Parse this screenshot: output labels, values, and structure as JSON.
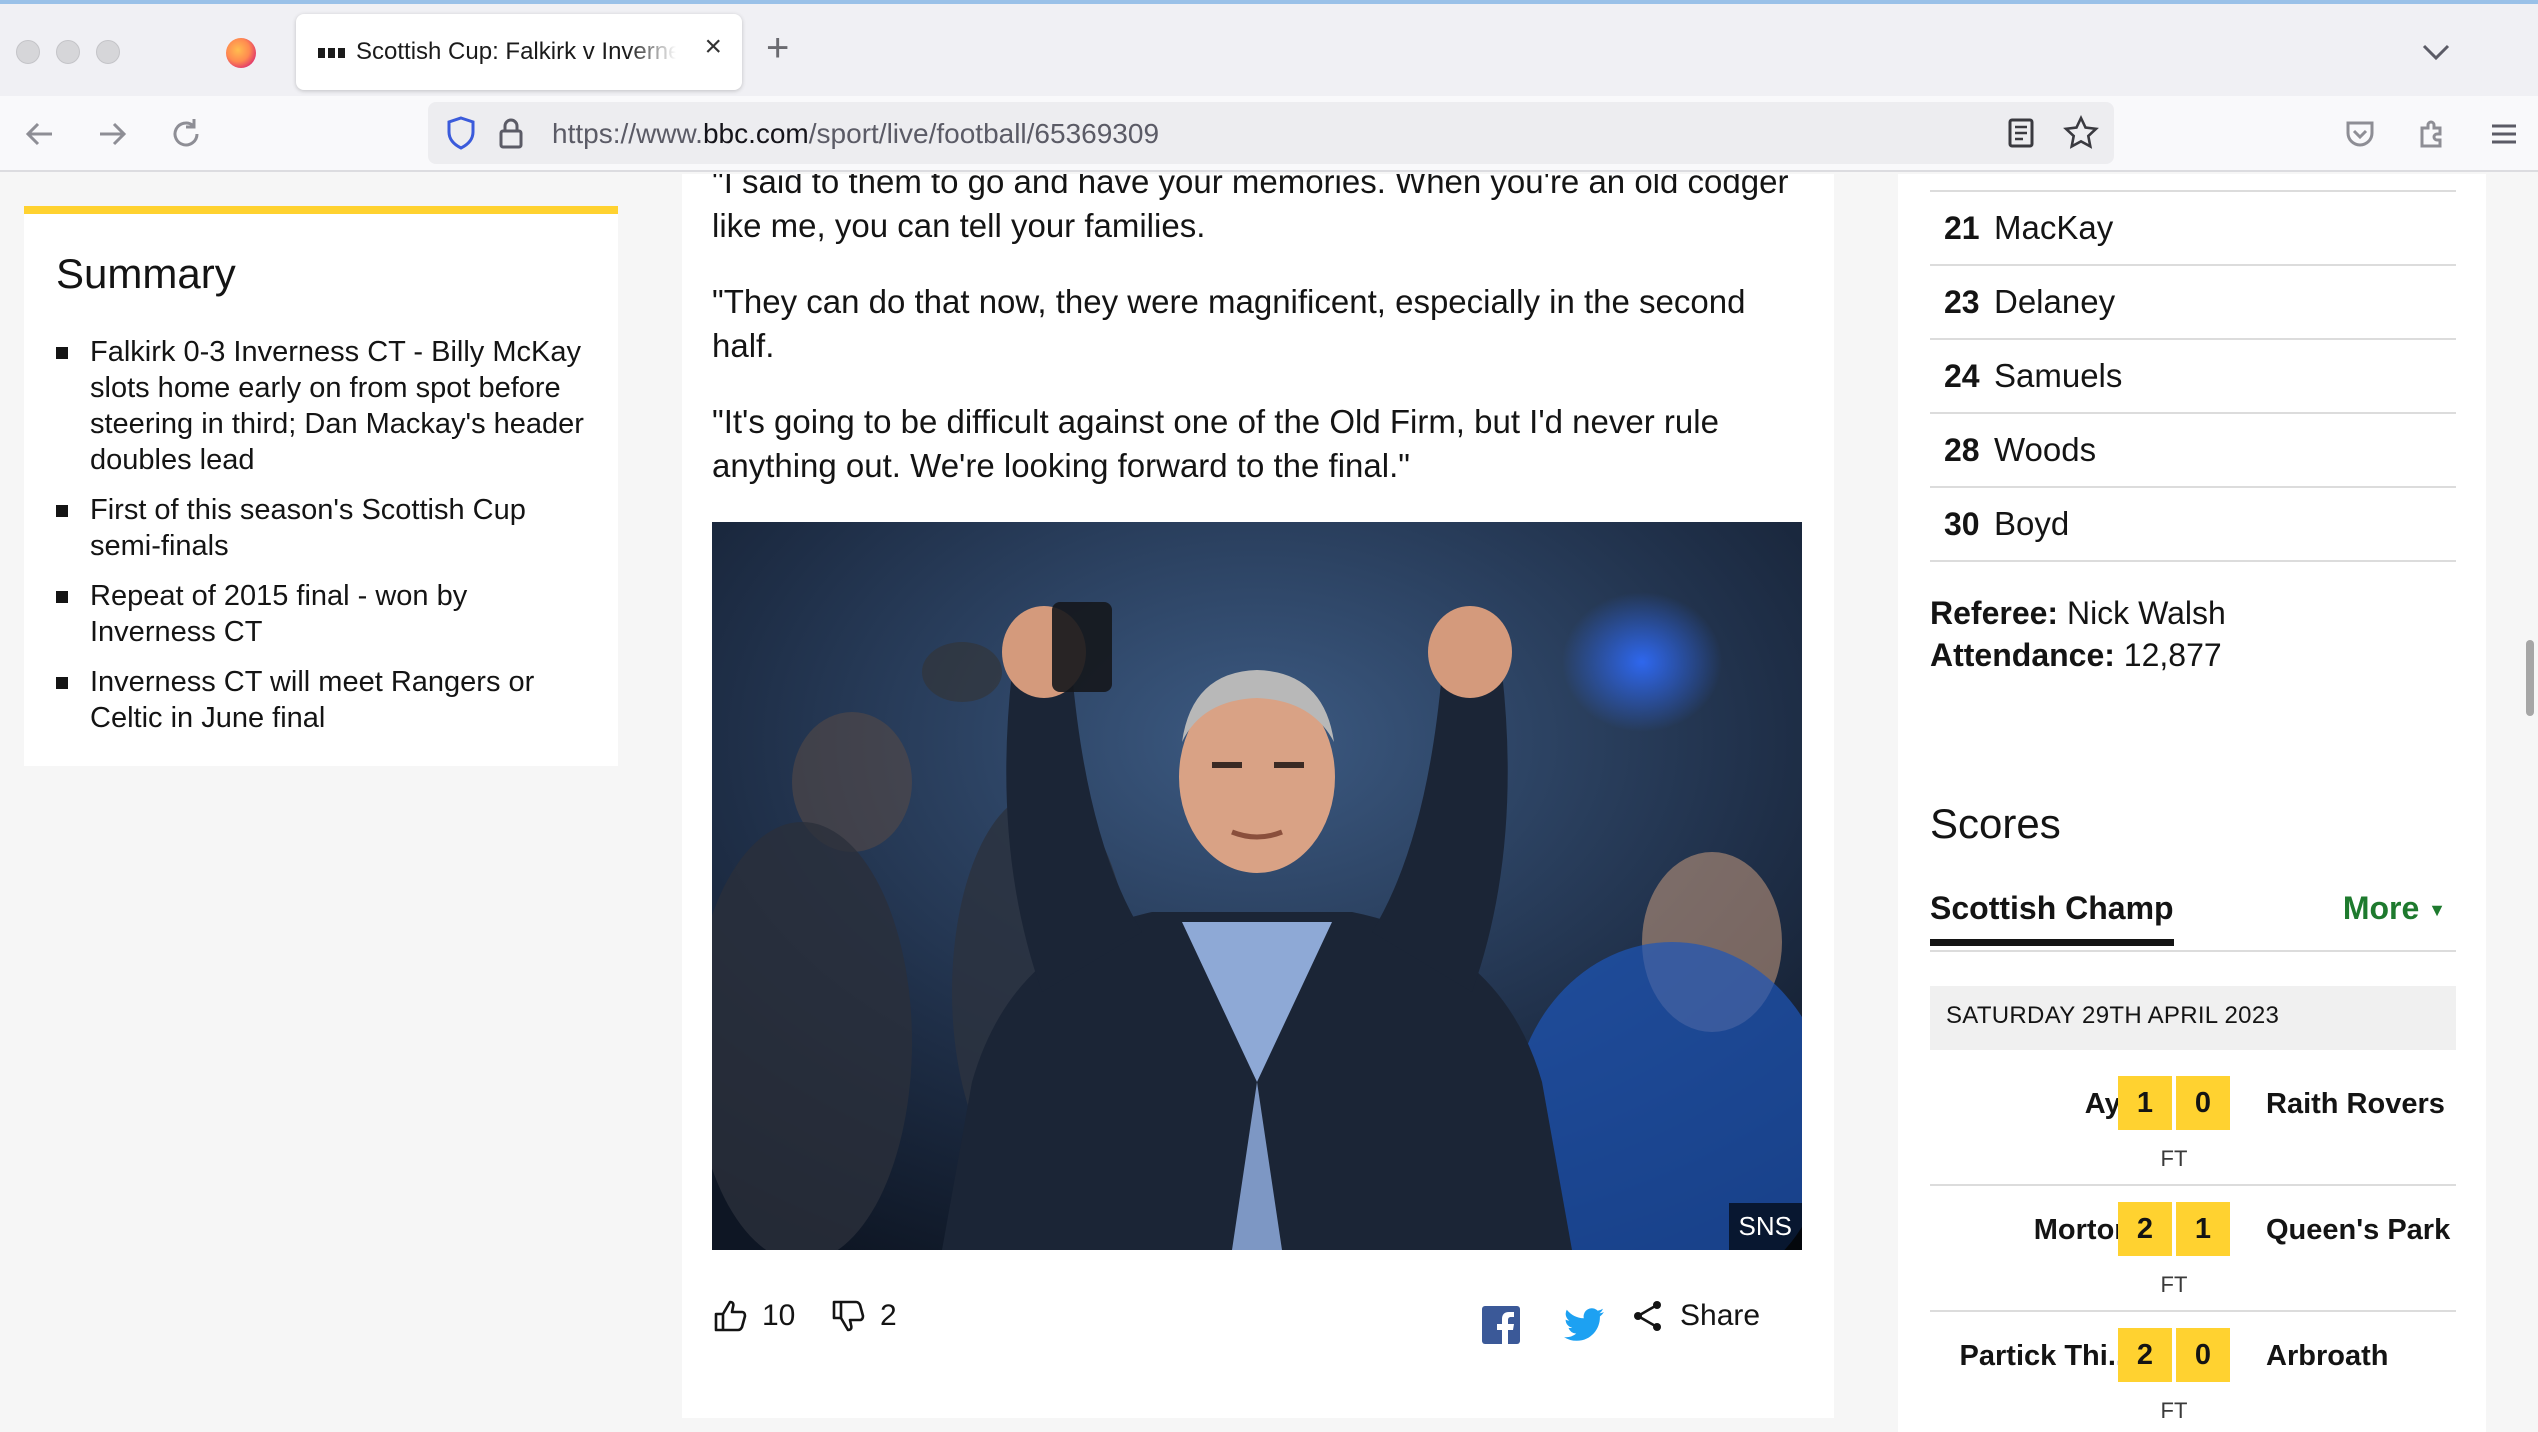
{
  "browser": {
    "tab_title": "Scottish Cup: Falkirk v Inverness CT",
    "url_prefix": "https://www.",
    "url_domain": "bbc.com",
    "url_path": "/sport/live/football/65369309"
  },
  "summary": {
    "heading": "Summary",
    "items": [
      "Falkirk 0-3 Inverness CT - Billy McKay slots home early on from spot before steering in third; Dan Mackay's header doubles lead",
      "First of this season's Scottish Cup semi-finals",
      "Repeat of 2015 final - won by Inverness CT",
      "Inverness CT will meet Rangers or Celtic in June final"
    ]
  },
  "article": {
    "paragraphs": [
      "\"I said to them to go and have your memories. When you're an old codger like me, you can tell your families.",
      "\"They can do that now, they were magnificent, especially in the second half.",
      "\"It's going to be difficult against one of the Old Firm, but I'd never rule anything out. We're looking forward to the final.\""
    ],
    "image_credit": "SNS",
    "likes": "10",
    "dislikes": "2",
    "share_label": "Share"
  },
  "lineup": {
    "players": [
      {
        "number": "21",
        "name": "MacKay"
      },
      {
        "number": "23",
        "name": "Delaney"
      },
      {
        "number": "24",
        "name": "Samuels"
      },
      {
        "number": "28",
        "name": "Woods"
      },
      {
        "number": "30",
        "name": "Boyd"
      }
    ],
    "referee_label": "Referee:",
    "referee": "Nick Walsh",
    "attendance_label": "Attendance:",
    "attendance": "12,877"
  },
  "scores": {
    "heading": "Scores",
    "tab_label": "Scottish Champ",
    "more_label": "More",
    "date": "SATURDAY 29TH APRIL 2023",
    "matches": [
      {
        "home": "Ayr",
        "home_score": "1",
        "away_score": "0",
        "away": "Raith Rovers",
        "status": "FT"
      },
      {
        "home": "Morton",
        "home_score": "2",
        "away_score": "1",
        "away": "Queen's Park",
        "status": "FT"
      },
      {
        "home": "Partick Thi...",
        "home_score": "2",
        "away_score": "0",
        "away": "Arbroath",
        "status": "FT"
      }
    ]
  },
  "colors": {
    "accent_yellow": "#ffd230",
    "more_green": "#1e7a2e"
  }
}
